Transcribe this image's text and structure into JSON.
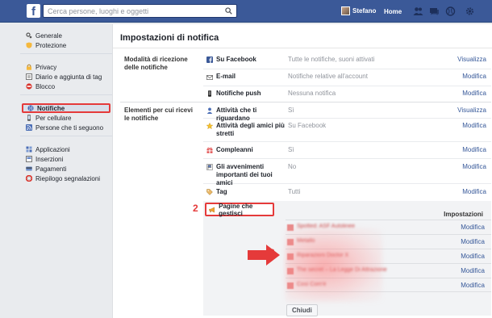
{
  "topbar": {
    "logo": "f",
    "search_placeholder": "Cerca persone, luoghi e oggetti",
    "user_name": "Stefano",
    "home_label": "Home"
  },
  "sidebar": {
    "groups": [
      [
        {
          "label": "Generale",
          "icon": "gear-icon"
        },
        {
          "label": "Protezione",
          "icon": "shield-icon"
        }
      ],
      [
        {
          "label": "Privacy",
          "icon": "lock-icon"
        },
        {
          "label": "Diario e aggiunta di tag",
          "icon": "timeline-icon"
        },
        {
          "label": "Blocco",
          "icon": "block-icon"
        }
      ],
      [
        {
          "label": "Notifiche",
          "icon": "globe-icon"
        },
        {
          "label": "Per cellulare",
          "icon": "mobile-icon"
        },
        {
          "label": "Persone che ti seguono",
          "icon": "rss-icon"
        }
      ],
      [
        {
          "label": "Applicazioni",
          "icon": "apps-icon"
        },
        {
          "label": "Inserzioni",
          "icon": "ads-icon"
        },
        {
          "label": "Pagamenti",
          "icon": "payments-icon"
        },
        {
          "label": "Riepilogo segnalazioni",
          "icon": "support-icon"
        }
      ]
    ]
  },
  "main": {
    "title": "Impostazioni di notifica",
    "section1_label": "Modalità di ricezione delle notifiche",
    "section1_rows": [
      {
        "label": "Su Facebook",
        "value": "Tutte le notifiche, suoni attivati",
        "link": "Visualizza"
      },
      {
        "label": "E-mail",
        "value": "Notifiche relative all'account",
        "link": "Modifica"
      },
      {
        "label": "Notifiche push",
        "value": "Nessuna notifica",
        "link": "Modifica"
      }
    ],
    "section2_label": "Elementi per cui ricevi le notifiche",
    "section2_rows": [
      {
        "label": "Attività che ti riguardano",
        "value": "Sì",
        "link": "Visualizza"
      },
      {
        "label": "Attività degli amici più stretti",
        "value": "Su Facebook",
        "link": "Modifica"
      },
      {
        "label": "Compleanni",
        "value": "Sì",
        "link": "Modifica"
      },
      {
        "label": "Gli avvenimenti importanti dei tuoi amici",
        "value": "No",
        "link": "Modifica"
      },
      {
        "label": "Tag",
        "value": "Tutti",
        "link": "Modifica"
      }
    ],
    "pages": {
      "label": "Pagine che gestisci",
      "settings_header": "Impostazioni",
      "items": [
        {
          "name": "Spotted: ASF Autolinee",
          "link": "Modifica"
        },
        {
          "name": "Metallo",
          "link": "Modifica"
        },
        {
          "name": "Riparazioni Doctor X",
          "link": "Modifica"
        },
        {
          "name": "The secret – La Legge Di Attrazione",
          "link": "Modifica"
        },
        {
          "name": "Così Com'è",
          "link": "Modifica"
        }
      ],
      "close_label": "Chiudi"
    }
  },
  "annotations": {
    "one": "1",
    "two": "2",
    "three": "3"
  },
  "colors": {
    "brand": "#3b5998",
    "link": "#365899",
    "annotation": "#e53a3a"
  }
}
